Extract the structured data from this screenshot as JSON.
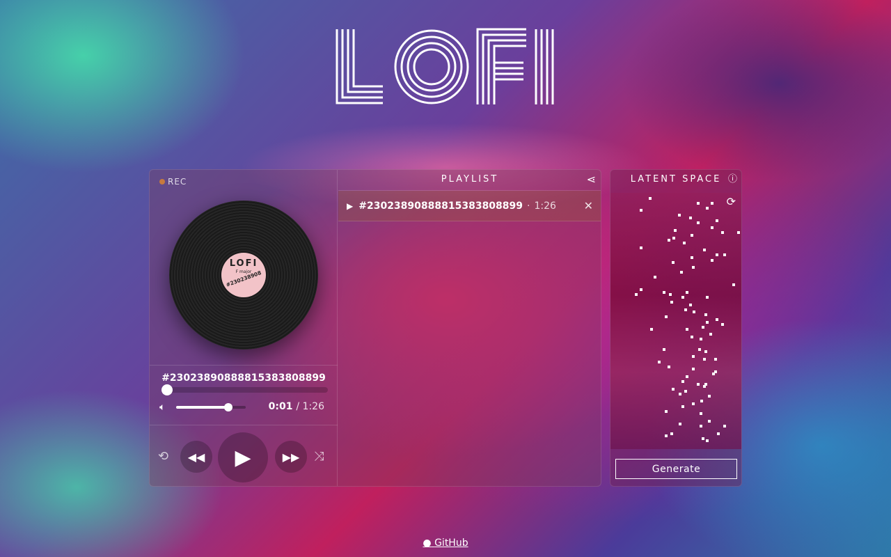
{
  "logo": {
    "text": "LOFI"
  },
  "recorder": {
    "rec_label": "REC"
  },
  "record": {
    "label_title": "LOFI",
    "label_key": "F major",
    "label_id": "#230238908"
  },
  "now_playing": {
    "title": "#23023890888815383808899",
    "current_time": "0:01",
    "duration": "1:26",
    "progress": 0.02,
    "volume": 0.75
  },
  "playlist": {
    "header": "PLAYLIST",
    "items": [
      {
        "name": "#23023890888815383808899",
        "duration": "1:26"
      }
    ]
  },
  "latent": {
    "header": "LATENT SPACE",
    "generate_label": "Generate",
    "points": [
      [
        0.29,
        0.01
      ],
      [
        0.67,
        0.03
      ],
      [
        0.78,
        0.03
      ],
      [
        0.74,
        0.05
      ],
      [
        0.22,
        0.06
      ],
      [
        0.52,
        0.08
      ],
      [
        0.61,
        0.09
      ],
      [
        0.82,
        0.1
      ],
      [
        0.67,
        0.11
      ],
      [
        0.78,
        0.13
      ],
      [
        0.49,
        0.14
      ],
      [
        0.86,
        0.15
      ],
      [
        0.99,
        0.15
      ],
      [
        0.62,
        0.16
      ],
      [
        0.48,
        0.17
      ],
      [
        0.44,
        0.18
      ],
      [
        0.56,
        0.19
      ],
      [
        0.22,
        0.21
      ],
      [
        0.72,
        0.22
      ],
      [
        0.88,
        0.24
      ],
      [
        0.82,
        0.24
      ],
      [
        0.62,
        0.25
      ],
      [
        0.78,
        0.26
      ],
      [
        0.47,
        0.27
      ],
      [
        0.63,
        0.29
      ],
      [
        0.54,
        0.31
      ],
      [
        0.33,
        0.33
      ],
      [
        0.95,
        0.36
      ],
      [
        0.22,
        0.38
      ],
      [
        0.4,
        0.39
      ],
      [
        0.58,
        0.39
      ],
      [
        0.45,
        0.4
      ],
      [
        0.55,
        0.41
      ],
      [
        0.18,
        0.4
      ],
      [
        0.74,
        0.41
      ],
      [
        0.46,
        0.43
      ],
      [
        0.61,
        0.44
      ],
      [
        0.57,
        0.46
      ],
      [
        0.64,
        0.47
      ],
      [
        0.42,
        0.49
      ],
      [
        0.73,
        0.48
      ],
      [
        0.82,
        0.5
      ],
      [
        0.74,
        0.51
      ],
      [
        0.86,
        0.52
      ],
      [
        0.71,
        0.53
      ],
      [
        0.58,
        0.54
      ],
      [
        0.3,
        0.54
      ],
      [
        0.77,
        0.56
      ],
      [
        0.62,
        0.57
      ],
      [
        0.69,
        0.58
      ],
      [
        0.4,
        0.62
      ],
      [
        0.68,
        0.62
      ],
      [
        0.73,
        0.63
      ],
      [
        0.63,
        0.65
      ],
      [
        0.72,
        0.66
      ],
      [
        0.81,
        0.66
      ],
      [
        0.36,
        0.67
      ],
      [
        0.44,
        0.69
      ],
      [
        0.63,
        0.7
      ],
      [
        0.81,
        0.71
      ],
      [
        0.79,
        0.72
      ],
      [
        0.58,
        0.73
      ],
      [
        0.55,
        0.75
      ],
      [
        0.67,
        0.76
      ],
      [
        0.73,
        0.76
      ],
      [
        0.47,
        0.78
      ],
      [
        0.72,
        0.77
      ],
      [
        0.57,
        0.79
      ],
      [
        0.53,
        0.8
      ],
      [
        0.76,
        0.81
      ],
      [
        0.7,
        0.83
      ],
      [
        0.63,
        0.84
      ],
      [
        0.55,
        0.85
      ],
      [
        0.42,
        0.87
      ],
      [
        0.69,
        0.88
      ],
      [
        0.76,
        0.91
      ],
      [
        0.53,
        0.92
      ],
      [
        0.69,
        0.93
      ],
      [
        0.88,
        0.93
      ],
      [
        0.46,
        0.96
      ],
      [
        0.42,
        0.97
      ],
      [
        0.83,
        0.96
      ],
      [
        0.71,
        0.98
      ],
      [
        0.74,
        0.99
      ]
    ]
  },
  "footer": {
    "github_label": "GitHub"
  },
  "colors": {
    "accent": "#f06090",
    "rec_dot": "#c77a3d",
    "record_label": "#f2c3c8"
  },
  "icons": [
    "rec-dot-icon",
    "volume-icon",
    "repeat-icon",
    "rewind-icon",
    "play-icon",
    "fast-forward-icon",
    "shuffle-icon",
    "share-icon",
    "close-icon",
    "help-icon",
    "refresh-icon",
    "github-icon"
  ]
}
